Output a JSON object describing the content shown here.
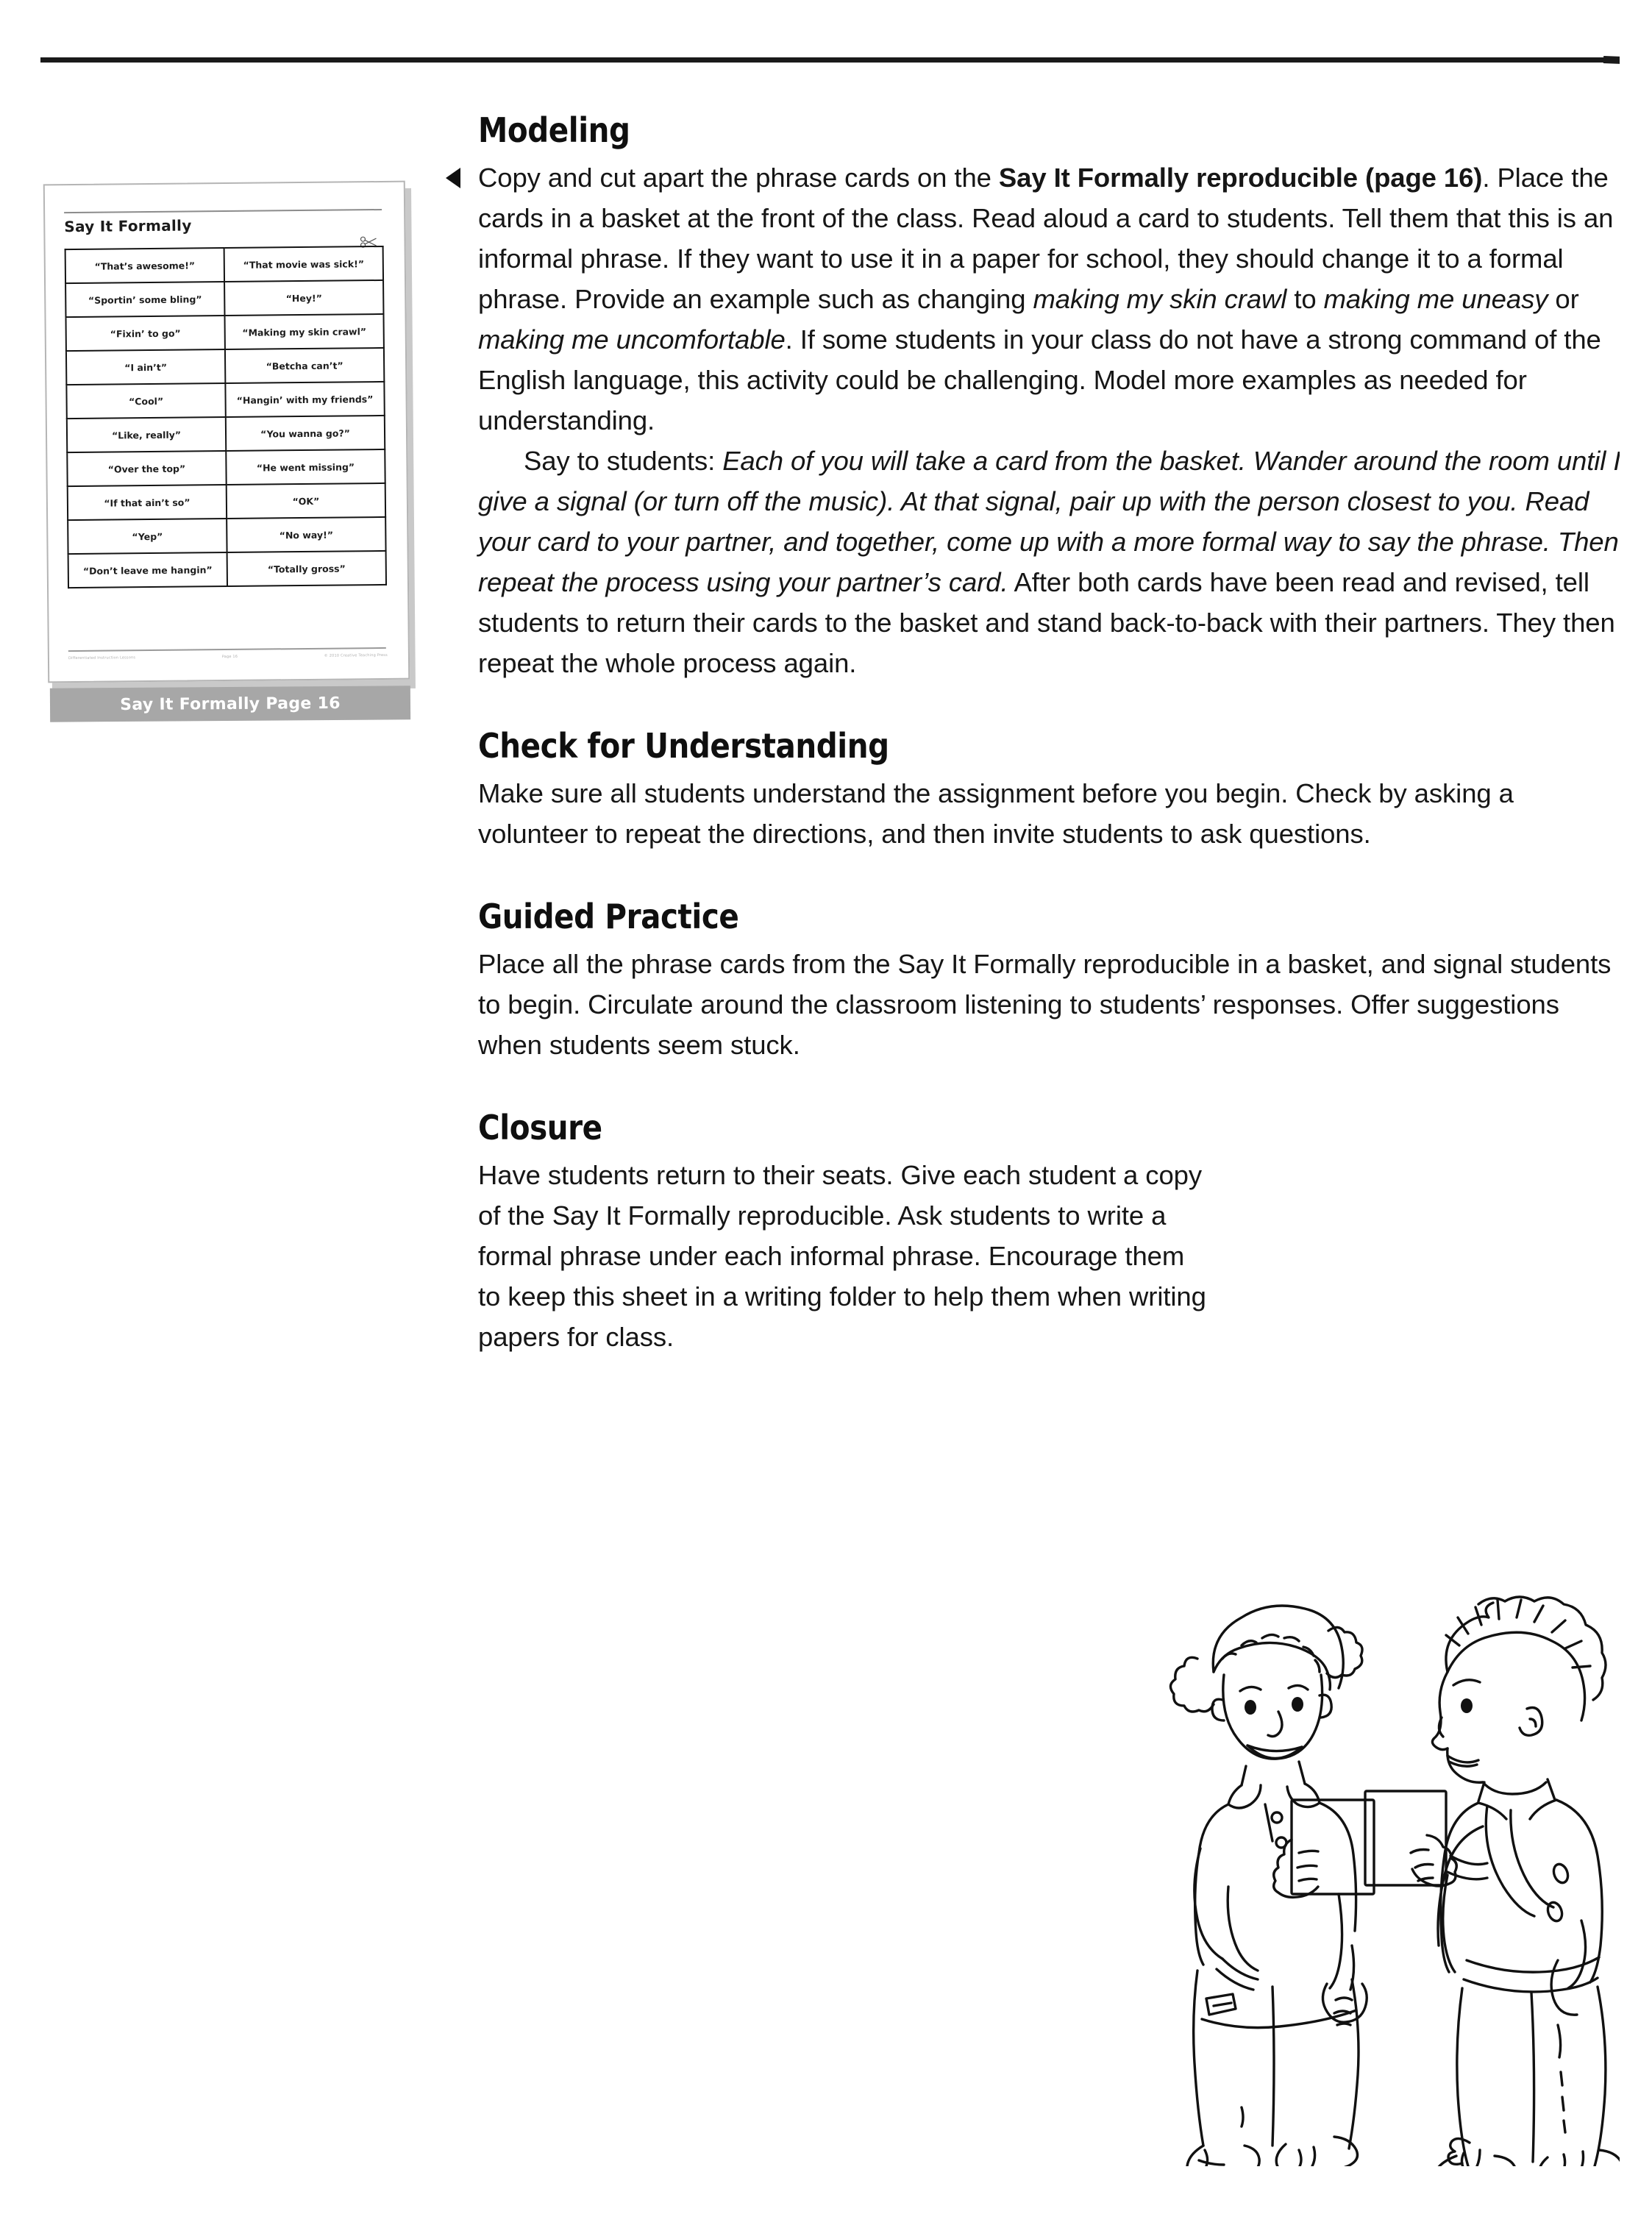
{
  "thumbnail": {
    "title": "Say It Formally",
    "caption": "Say It Formally Page 16",
    "decoration_icon": "scissors-icon",
    "footer_left": "Differentiated Instruction Lessons",
    "footer_center": "Page 16",
    "footer_right": "© 2010 Creative Teaching Press",
    "table": {
      "rows": [
        [
          "“That’s awesome!”",
          "“That movie was sick!”"
        ],
        [
          "“Sportin’ some bling”",
          "“Hey!”"
        ],
        [
          "“Fixin’ to go”",
          "“Making my skin crawl”"
        ],
        [
          "“I ain’t”",
          "“Betcha can’t”"
        ],
        [
          "“Cool”",
          "“Hangin’ with my friends”"
        ],
        [
          "“Like, really”",
          "“You wanna go?”"
        ],
        [
          "“Over the top”",
          "“He went missing”"
        ],
        [
          "“If that ain’t so”",
          "“OK”"
        ],
        [
          "“Yep”",
          "“No way!”"
        ],
        [
          "“Don’t leave me hangin”",
          "“Totally gross”"
        ]
      ]
    }
  },
  "sections": {
    "modeling": {
      "heading": "Modeling",
      "bullet_icon": "triangle-left-bullet",
      "p1_a": "Copy and cut apart the phrase cards on the ",
      "p1_bold1": "Say It Formally reproducible (page 16)",
      "p1_b": ". Place the cards in a basket at the front of the class. Read aloud a card to students. Tell them that this is an informal phrase. If they want to use it in a paper for school, they should change it to a formal phrase. Provide an example such as changing ",
      "p1_ital1": "making my skin crawl",
      "p1_c": " to ",
      "p1_ital2": "making me uneasy",
      "p1_d": " or ",
      "p1_ital3": "making me uncomfortable",
      "p1_e": ". If some students in your class do not have a strong command of the English language, this activity could be challenging. Model more examples as needed for understanding.",
      "p2_a": "Say to students: ",
      "p2_ital1": "Each of you will take a card from the basket. Wander around the room until I give a signal (or turn off the music). At that signal, pair up with the person closest to you. Read your card to your partner, and together, come up with a more formal way to say the phrase. Then repeat the process using your partner’s card.",
      "p2_b": " After both cards have been read and revised, tell students to return their cards to the basket and stand back-to-back with their partners. They then repeat the whole process again."
    },
    "check_for_understanding": {
      "heading": "Check for Understanding",
      "body": "Make sure all students understand the assignment before you begin. Check by asking a volunteer to repeat the directions, and then invite students to ask questions."
    },
    "guided_practice": {
      "heading": "Guided Practice",
      "body": "Place all the phrase cards from the Say It Formally reproducible in a basket, and signal students to begin. Circulate around the classroom listening to students’ responses. Offer suggestions when students seem stuck."
    },
    "closure": {
      "heading": "Closure",
      "body": "Have students return to their seats. Give each student a copy of the Say It Formally reproducible. Ask students to write a formal phrase under each informal phrase. Encourage them to keep this sheet in a writing folder to help them when writing papers for class."
    }
  },
  "illustration": {
    "name": "two-students-holding-cards-illustration",
    "alt": "Line drawing of a girl and a boy each holding a phrase card"
  },
  "colors": {
    "ink": "#161616",
    "heading": "#0f0f0f",
    "caption_bar": "#a7a7a7",
    "rule": "#1a1a1a"
  }
}
